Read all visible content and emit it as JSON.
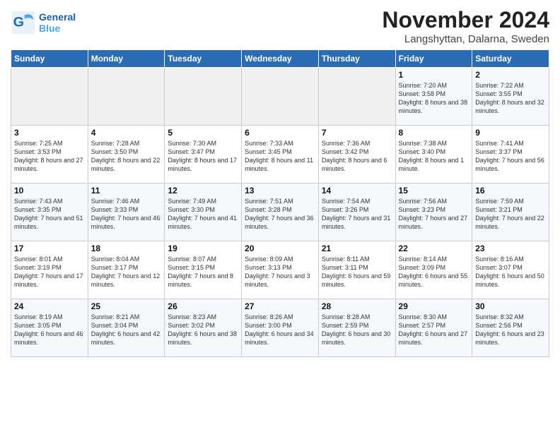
{
  "logo": {
    "text_general": "General",
    "text_blue": "Blue"
  },
  "title": "November 2024",
  "location": "Langshyttan, Dalarna, Sweden",
  "weekdays": [
    "Sunday",
    "Monday",
    "Tuesday",
    "Wednesday",
    "Thursday",
    "Friday",
    "Saturday"
  ],
  "weeks": [
    [
      {
        "day": "",
        "info": ""
      },
      {
        "day": "",
        "info": ""
      },
      {
        "day": "",
        "info": ""
      },
      {
        "day": "",
        "info": ""
      },
      {
        "day": "",
        "info": ""
      },
      {
        "day": "1",
        "info": "Sunrise: 7:20 AM\nSunset: 3:58 PM\nDaylight: 8 hours and 38 minutes."
      },
      {
        "day": "2",
        "info": "Sunrise: 7:22 AM\nSunset: 3:55 PM\nDaylight: 8 hours and 32 minutes."
      }
    ],
    [
      {
        "day": "3",
        "info": "Sunrise: 7:25 AM\nSunset: 3:53 PM\nDaylight: 8 hours and 27 minutes."
      },
      {
        "day": "4",
        "info": "Sunrise: 7:28 AM\nSunset: 3:50 PM\nDaylight: 8 hours and 22 minutes."
      },
      {
        "day": "5",
        "info": "Sunrise: 7:30 AM\nSunset: 3:47 PM\nDaylight: 8 hours and 17 minutes."
      },
      {
        "day": "6",
        "info": "Sunrise: 7:33 AM\nSunset: 3:45 PM\nDaylight: 8 hours and 11 minutes."
      },
      {
        "day": "7",
        "info": "Sunrise: 7:36 AM\nSunset: 3:42 PM\nDaylight: 8 hours and 6 minutes."
      },
      {
        "day": "8",
        "info": "Sunrise: 7:38 AM\nSunset: 3:40 PM\nDaylight: 8 hours and 1 minute."
      },
      {
        "day": "9",
        "info": "Sunrise: 7:41 AM\nSunset: 3:37 PM\nDaylight: 7 hours and 56 minutes."
      }
    ],
    [
      {
        "day": "10",
        "info": "Sunrise: 7:43 AM\nSunset: 3:35 PM\nDaylight: 7 hours and 51 minutes."
      },
      {
        "day": "11",
        "info": "Sunrise: 7:46 AM\nSunset: 3:33 PM\nDaylight: 7 hours and 46 minutes."
      },
      {
        "day": "12",
        "info": "Sunrise: 7:49 AM\nSunset: 3:30 PM\nDaylight: 7 hours and 41 minutes."
      },
      {
        "day": "13",
        "info": "Sunrise: 7:51 AM\nSunset: 3:28 PM\nDaylight: 7 hours and 36 minutes."
      },
      {
        "day": "14",
        "info": "Sunrise: 7:54 AM\nSunset: 3:26 PM\nDaylight: 7 hours and 31 minutes."
      },
      {
        "day": "15",
        "info": "Sunrise: 7:56 AM\nSunset: 3:23 PM\nDaylight: 7 hours and 27 minutes."
      },
      {
        "day": "16",
        "info": "Sunrise: 7:59 AM\nSunset: 3:21 PM\nDaylight: 7 hours and 22 minutes."
      }
    ],
    [
      {
        "day": "17",
        "info": "Sunrise: 8:01 AM\nSunset: 3:19 PM\nDaylight: 7 hours and 17 minutes."
      },
      {
        "day": "18",
        "info": "Sunrise: 8:04 AM\nSunset: 3:17 PM\nDaylight: 7 hours and 12 minutes."
      },
      {
        "day": "19",
        "info": "Sunrise: 8:07 AM\nSunset: 3:15 PM\nDaylight: 7 hours and 8 minutes."
      },
      {
        "day": "20",
        "info": "Sunrise: 8:09 AM\nSunset: 3:13 PM\nDaylight: 7 hours and 3 minutes."
      },
      {
        "day": "21",
        "info": "Sunrise: 8:11 AM\nSunset: 3:11 PM\nDaylight: 6 hours and 59 minutes."
      },
      {
        "day": "22",
        "info": "Sunrise: 8:14 AM\nSunset: 3:09 PM\nDaylight: 6 hours and 55 minutes."
      },
      {
        "day": "23",
        "info": "Sunrise: 8:16 AM\nSunset: 3:07 PM\nDaylight: 6 hours and 50 minutes."
      }
    ],
    [
      {
        "day": "24",
        "info": "Sunrise: 8:19 AM\nSunset: 3:05 PM\nDaylight: 6 hours and 46 minutes."
      },
      {
        "day": "25",
        "info": "Sunrise: 8:21 AM\nSunset: 3:04 PM\nDaylight: 6 hours and 42 minutes."
      },
      {
        "day": "26",
        "info": "Sunrise: 8:23 AM\nSunset: 3:02 PM\nDaylight: 6 hours and 38 minutes."
      },
      {
        "day": "27",
        "info": "Sunrise: 8:26 AM\nSunset: 3:00 PM\nDaylight: 6 hours and 34 minutes."
      },
      {
        "day": "28",
        "info": "Sunrise: 8:28 AM\nSunset: 2:59 PM\nDaylight: 6 hours and 30 minutes."
      },
      {
        "day": "29",
        "info": "Sunrise: 8:30 AM\nSunset: 2:57 PM\nDaylight: 6 hours and 27 minutes."
      },
      {
        "day": "30",
        "info": "Sunrise: 8:32 AM\nSunset: 2:56 PM\nDaylight: 6 hours and 23 minutes."
      }
    ]
  ]
}
